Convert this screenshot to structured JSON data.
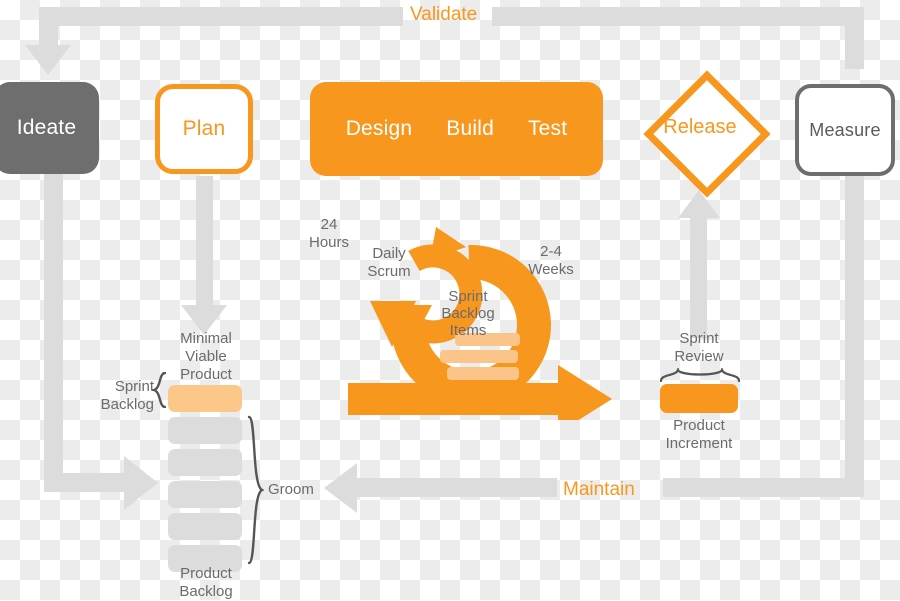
{
  "diagram": {
    "title": "Agile / Scrum lifecycle diagram",
    "colors": {
      "orange": "#F8971D",
      "light_orange": "#FBC889",
      "gray_line": "#dcdcdc",
      "dark_gray": "#6e6e6e",
      "text_gray": "#6b6b6b",
      "white": "#ffffff"
    }
  },
  "stages": {
    "ideate": "Ideate",
    "plan": "Plan",
    "design": "Design",
    "build": "Build",
    "test": "Test",
    "release": "Release",
    "measure": "Measure"
  },
  "edges": {
    "validate": "Validate",
    "maintain": "Maintain"
  },
  "backlog": {
    "sprint_backlog_label": "Sprint\nBacklog",
    "minimal_viable_product_label": "Minimal\nViable\nProduct",
    "product_backlog_label": "Product\nBacklog",
    "groom_label": "Groom",
    "items": [
      {
        "kind": "sprint",
        "color": "#FBC889"
      },
      {
        "kind": "product",
        "color": "#dcdcdc"
      },
      {
        "kind": "product",
        "color": "#dcdcdc"
      },
      {
        "kind": "product",
        "color": "#dcdcdc"
      },
      {
        "kind": "product",
        "color": "#dcdcdc"
      },
      {
        "kind": "product",
        "color": "#dcdcdc"
      }
    ]
  },
  "scrum": {
    "daily_scrum_label": "Daily\nScrum",
    "daily_scrum_duration": "24\nHours",
    "sprint_duration": "2-4\nWeeks",
    "sprint_backlog_items_label": "Sprint\nBacklog\nItems",
    "sprint_item_bars": 4
  },
  "increment": {
    "sprint_review_label": "Sprint\nReview",
    "product_increment_label": "Product\nIncrement"
  }
}
